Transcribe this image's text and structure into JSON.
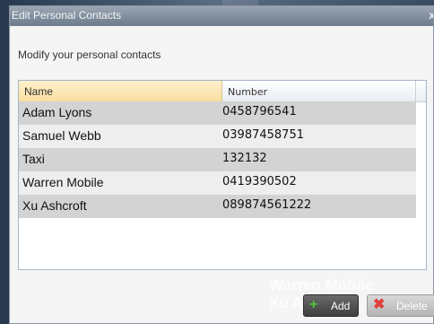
{
  "dialog": {
    "title": "Edit Personal Contacts",
    "close_label": "x",
    "subtitle": "Modify your personal contacts"
  },
  "grid": {
    "columns": [
      "Name",
      "Number"
    ],
    "rows": [
      {
        "name": "Adam Lyons",
        "number": "0458796541"
      },
      {
        "name": "Samuel Webb",
        "number": "03987458751"
      },
      {
        "name": "Taxi",
        "number": "132132"
      },
      {
        "name": "Warren Mobile",
        "number": "0419390502"
      },
      {
        "name": "Xu Ashcroft",
        "number": "089874561222"
      }
    ]
  },
  "background_ghost": {
    "line1": "Warren Mobile",
    "line2": "Xu A"
  },
  "buttons": {
    "add_label": "Add",
    "delete_label": "Delete",
    "add_icon": "plus-icon",
    "delete_icon": "x-delete-icon"
  },
  "colors": {
    "header_selected": "#f9dea0",
    "row_odd": "#d3d3d3",
    "row_even": "#eeeeee",
    "add_icon_color": "#4fc43a",
    "delete_icon_color": "#e0413a"
  }
}
